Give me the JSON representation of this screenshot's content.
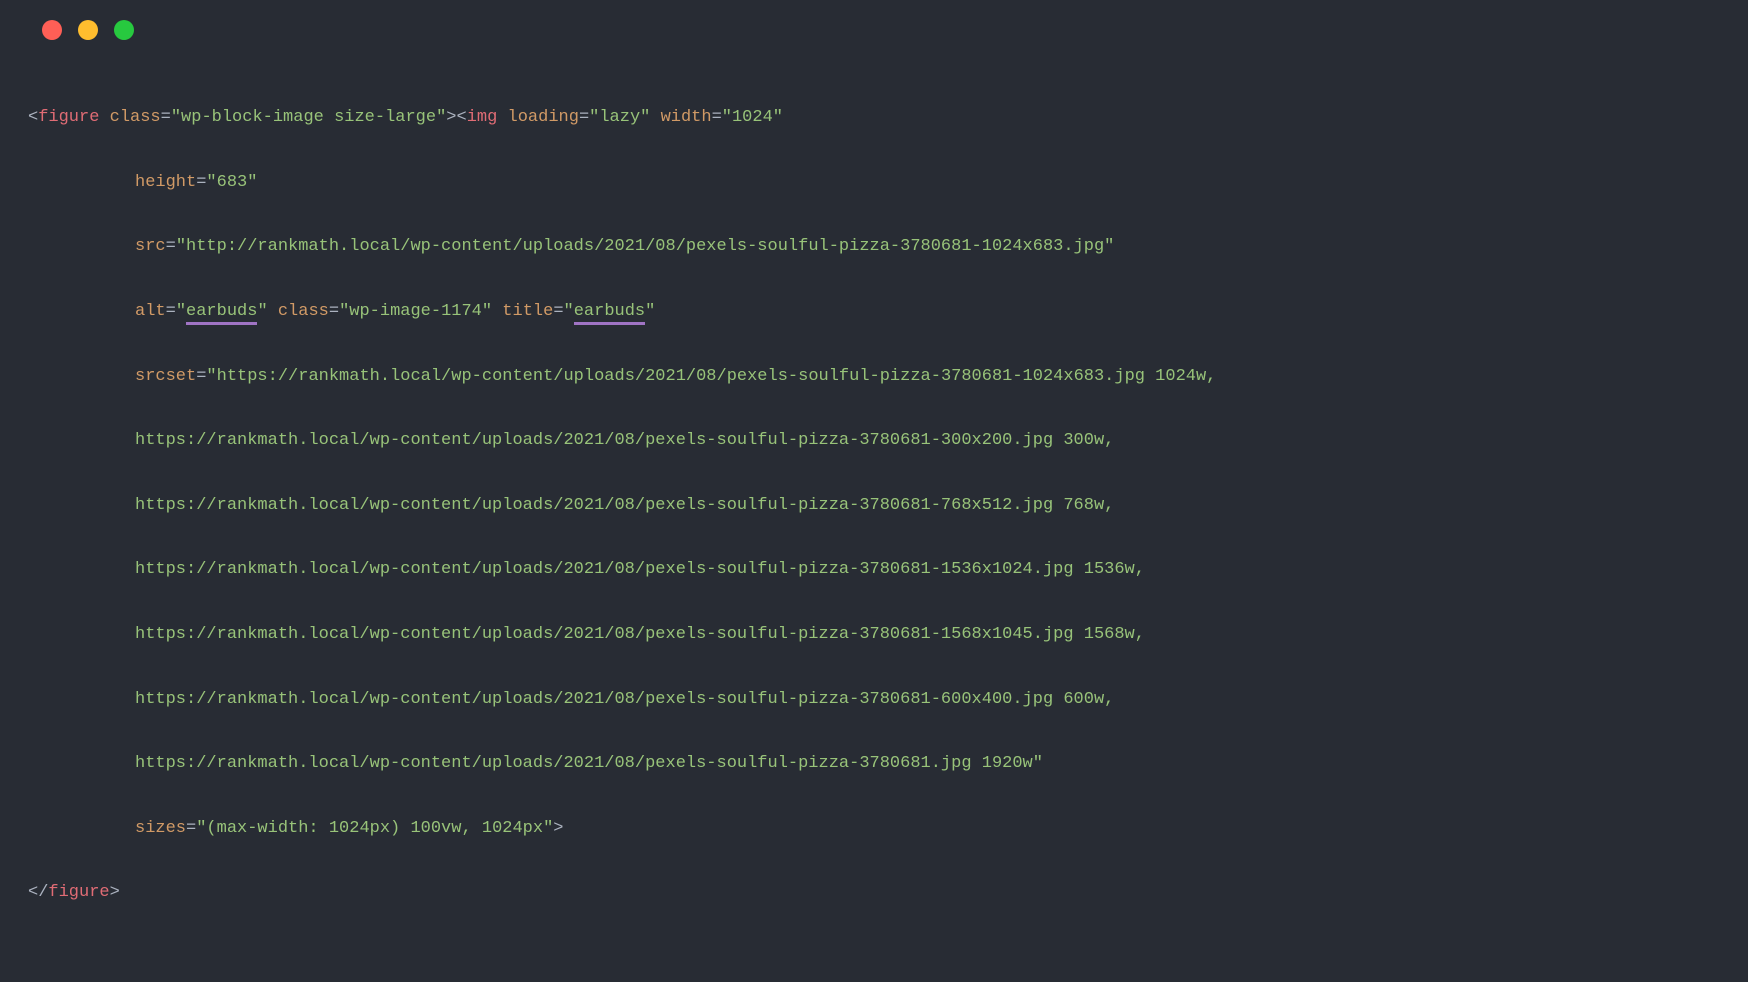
{
  "traffic": {
    "red": "red",
    "yellow": "yellow",
    "green": "green"
  },
  "code": {
    "l1": {
      "open": "<",
      "tag1": "figure",
      "sp1": " ",
      "a1": "class",
      "eq": "=",
      "v1": "\"wp-block-image size-large\"",
      "close1": ">",
      "open2": "<",
      "tag2": "img",
      "sp2": " ",
      "a2": "loading",
      "v2": "\"lazy\"",
      "sp3": " ",
      "a3": "width",
      "v3": "\"1024\""
    },
    "l2": {
      "a": "height",
      "eq": "=",
      "v": "\"683\""
    },
    "l3": {
      "a": "src",
      "eq": "=",
      "v": "\"http://rankmath.local/wp-content/uploads/2021/08/pexels-soulful-pizza-3780681-1024x683.jpg\""
    },
    "l4": {
      "a1": "alt",
      "eq": "=",
      "q": "\"",
      "v1": "earbuds",
      "qend": "\"",
      "sp": " ",
      "a2": "class",
      "v2": "\"wp-image-1174\"",
      "sp2": " ",
      "a3": "title",
      "v3": "earbuds"
    },
    "l5": {
      "a": "srcset",
      "eq": "=",
      "v": "\"https://rankmath.local/wp-content/uploads/2021/08/pexels-soulful-pizza-3780681-1024x683.jpg 1024w,"
    },
    "l6": {
      "v": "https://rankmath.local/wp-content/uploads/2021/08/pexels-soulful-pizza-3780681-300x200.jpg 300w,"
    },
    "l7": {
      "v": "https://rankmath.local/wp-content/uploads/2021/08/pexels-soulful-pizza-3780681-768x512.jpg 768w,"
    },
    "l8": {
      "v": "https://rankmath.local/wp-content/uploads/2021/08/pexels-soulful-pizza-3780681-1536x1024.jpg 1536w,"
    },
    "l9": {
      "v": "https://rankmath.local/wp-content/uploads/2021/08/pexels-soulful-pizza-3780681-1568x1045.jpg 1568w,"
    },
    "l10": {
      "v": "https://rankmath.local/wp-content/uploads/2021/08/pexels-soulful-pizza-3780681-600x400.jpg 600w,"
    },
    "l11": {
      "v": "https://rankmath.local/wp-content/uploads/2021/08/pexels-soulful-pizza-3780681.jpg 1920w\""
    },
    "l12": {
      "a": "sizes",
      "eq": "=",
      "v": "\"(max-width: 1024px) 100vw, 1024px\"",
      "close": ">"
    },
    "l13": {
      "open": "</",
      "tag": "figure",
      "close": ">"
    }
  }
}
